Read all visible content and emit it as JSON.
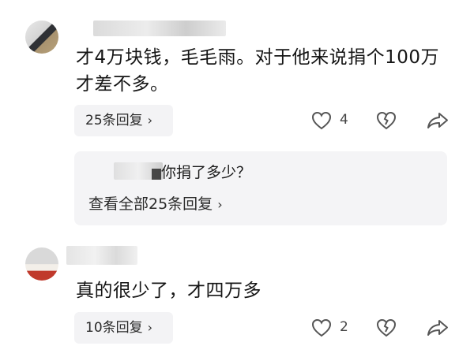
{
  "comments": [
    {
      "text": "才4万块钱，毛毛雨。对于他来说捐个100万才差不多。",
      "reply_label": "25条回复",
      "like_count": "4"
    },
    {
      "text": "真的很少了，才四万多",
      "reply_label": "10条回复",
      "like_count": "2"
    }
  ],
  "sub_reply": {
    "text": "你捐了多少？",
    "view_all_label": "查看全部25条回复"
  },
  "icons": {
    "like": "heart-outline-icon",
    "dislike": "broken-heart-icon",
    "share": "share-arrow-icon",
    "chevron": "chevron-right-icon"
  },
  "colors": {
    "background": "#ffffff",
    "pill_background": "#f3f3f5",
    "text": "#151515",
    "icon": "#555555"
  }
}
